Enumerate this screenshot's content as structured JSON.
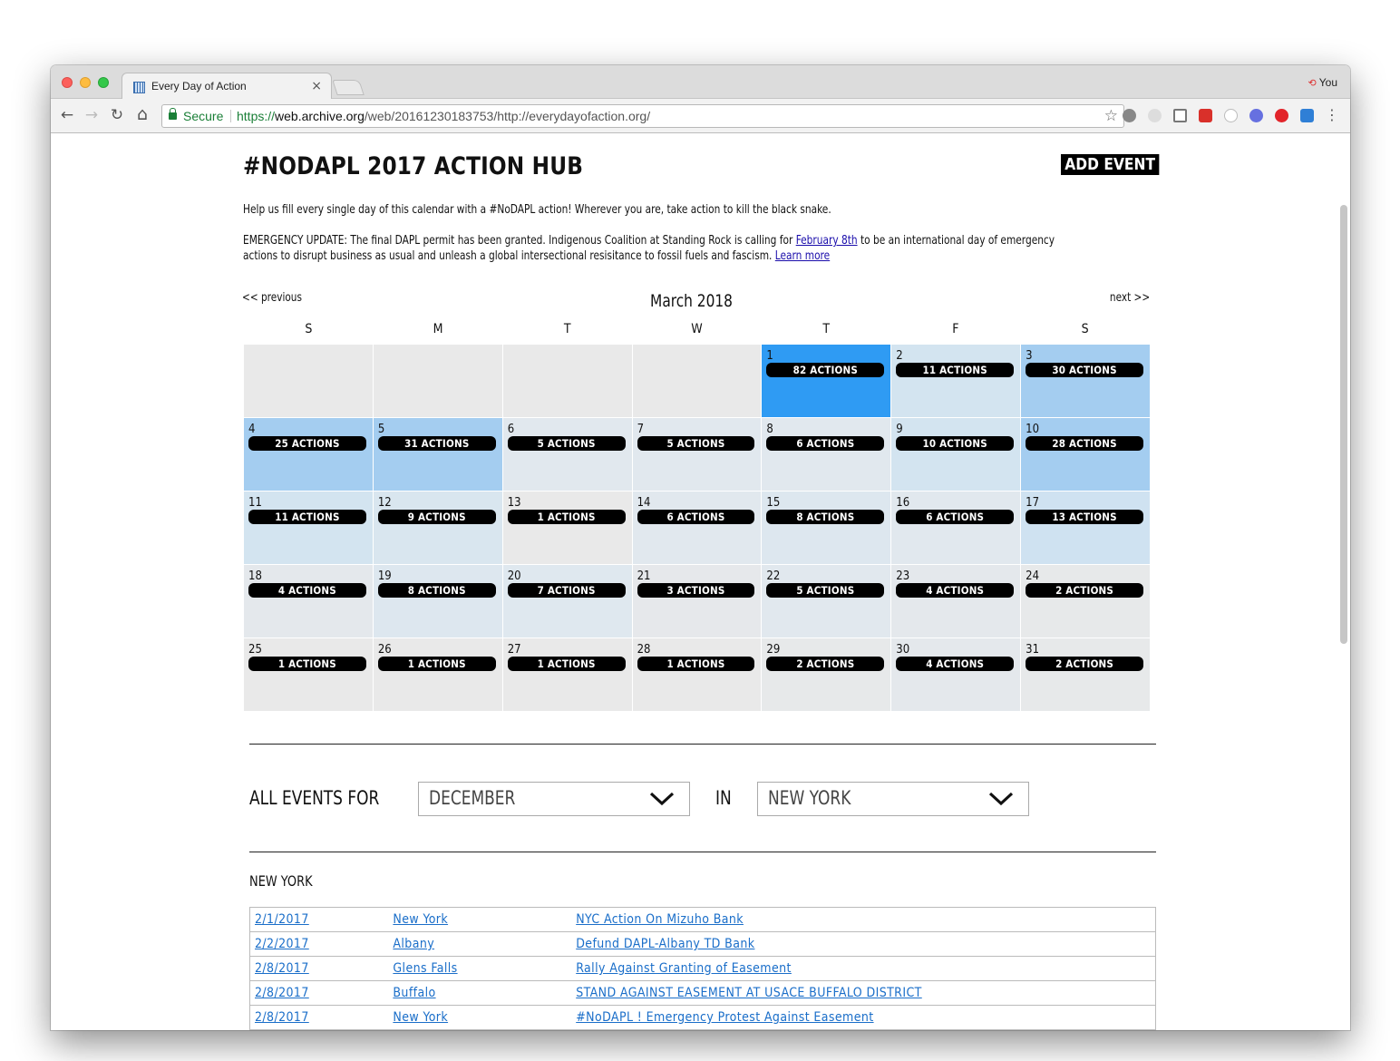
{
  "browser": {
    "tab_title": "Every Day of Action",
    "tab_close": "×",
    "profile_name": "You",
    "back": "←",
    "forward": "→",
    "reload": "↻",
    "home": "⌂",
    "secure_label": "Secure",
    "url_scheme": "https://",
    "url_host": "web.archive.org",
    "url_path": "/web/20161230183753/http://everydayofaction.org/",
    "star": "☆",
    "menu": "⋮"
  },
  "page": {
    "title": "#NODAPL 2017 ACTION HUB",
    "add_event": "ADD EVENT",
    "intro": "Help us fill every single day of this calendar with a #NoDAPL action! Wherever you are, take action to kill the black snake.",
    "update_before": "EMERGENCY UPDATE: The final DAPL permit has been granted. Indigenous Coalition at Standing Rock is calling for ",
    "update_link": "February 8th",
    "update_middle": " to be an international day of emergency actions to disrupt business as usual and unleash a global intersectional resisitance to fossil fuels and fascism. ",
    "update_link2": "Learn more"
  },
  "calendar": {
    "prev": "<< previous",
    "next": "next >>",
    "month": "March 2018",
    "weekdays": [
      "S",
      "M",
      "T",
      "W",
      "T",
      "F",
      "S"
    ],
    "leading_blanks": 4,
    "days": [
      {
        "day": "1",
        "label": "82 ACTIONS",
        "color": "#2f9bf3"
      },
      {
        "day": "2",
        "label": "11 ACTIONS",
        "color": "#d3e4f0"
      },
      {
        "day": "3",
        "label": "30 ACTIONS",
        "color": "#a4cdf0"
      },
      {
        "day": "4",
        "label": "25 ACTIONS",
        "color": "#a4cdf0"
      },
      {
        "day": "5",
        "label": "31 ACTIONS",
        "color": "#a4cdf0"
      },
      {
        "day": "6",
        "label": "5 ACTIONS",
        "color": "#e1e8ee"
      },
      {
        "day": "7",
        "label": "5 ACTIONS",
        "color": "#e1e8ee"
      },
      {
        "day": "8",
        "label": "6 ACTIONS",
        "color": "#e1e8ee"
      },
      {
        "day": "9",
        "label": "10 ACTIONS",
        "color": "#d3e4f0"
      },
      {
        "day": "10",
        "label": "28 ACTIONS",
        "color": "#a4cdf0"
      },
      {
        "day": "11",
        "label": "11 ACTIONS",
        "color": "#d3e4f0"
      },
      {
        "day": "12",
        "label": "9 ACTIONS",
        "color": "#d9e6ef"
      },
      {
        "day": "13",
        "label": "1 ACTIONS",
        "color": "#e9e9e9"
      },
      {
        "day": "14",
        "label": "6 ACTIONS",
        "color": "#e1e8ee"
      },
      {
        "day": "15",
        "label": "8 ACTIONS",
        "color": "#dde7ef"
      },
      {
        "day": "16",
        "label": "6 ACTIONS",
        "color": "#e1e8ee"
      },
      {
        "day": "17",
        "label": "13 ACTIONS",
        "color": "#cfe2f1"
      },
      {
        "day": "18",
        "label": "4 ACTIONS",
        "color": "#e4e8ec"
      },
      {
        "day": "19",
        "label": "8 ACTIONS",
        "color": "#dde7ef"
      },
      {
        "day": "20",
        "label": "7 ACTIONS",
        "color": "#dfe8ef"
      },
      {
        "day": "21",
        "label": "3 ACTIONS",
        "color": "#e6e8eb"
      },
      {
        "day": "22",
        "label": "5 ACTIONS",
        "color": "#e1e8ee"
      },
      {
        "day": "23",
        "label": "4 ACTIONS",
        "color": "#e4e8ec"
      },
      {
        "day": "24",
        "label": "2 ACTIONS",
        "color": "#e7e9ea"
      },
      {
        "day": "25",
        "label": "1 ACTIONS",
        "color": "#e9e9e9"
      },
      {
        "day": "26",
        "label": "1 ACTIONS",
        "color": "#e9e9e9"
      },
      {
        "day": "27",
        "label": "1 ACTIONS",
        "color": "#e9e9e9"
      },
      {
        "day": "28",
        "label": "1 ACTIONS",
        "color": "#e9e9e9"
      },
      {
        "day": "29",
        "label": "2 ACTIONS",
        "color": "#e7e9ea"
      },
      {
        "day": "30",
        "label": "4 ACTIONS",
        "color": "#e4e8ec"
      },
      {
        "day": "31",
        "label": "2 ACTIONS",
        "color": "#e7e9ea"
      }
    ]
  },
  "filter": {
    "label": "ALL EVENTS FOR",
    "month_value": "DECEMBER",
    "in_label": "IN",
    "location_value": "NEW YORK"
  },
  "events": {
    "section_title": "NEW YORK",
    "rows": [
      {
        "date": "2/1/2017",
        "city": "New York",
        "title": "NYC Action On Mizuho Bank"
      },
      {
        "date": "2/2/2017",
        "city": "Albany",
        "title": "Defund DAPL-Albany TD Bank"
      },
      {
        "date": "2/8/2017",
        "city": "Glens Falls",
        "title": "Rally Against Granting of Easement"
      },
      {
        "date": "2/8/2017",
        "city": "Buffalo",
        "title": "STAND AGAINST EASEMENT AT USACE BUFFALO DISTRICT"
      },
      {
        "date": "2/8/2017",
        "city": "New York",
        "title": "#NoDAPL ! Emergency Protest Against Easement"
      }
    ]
  }
}
